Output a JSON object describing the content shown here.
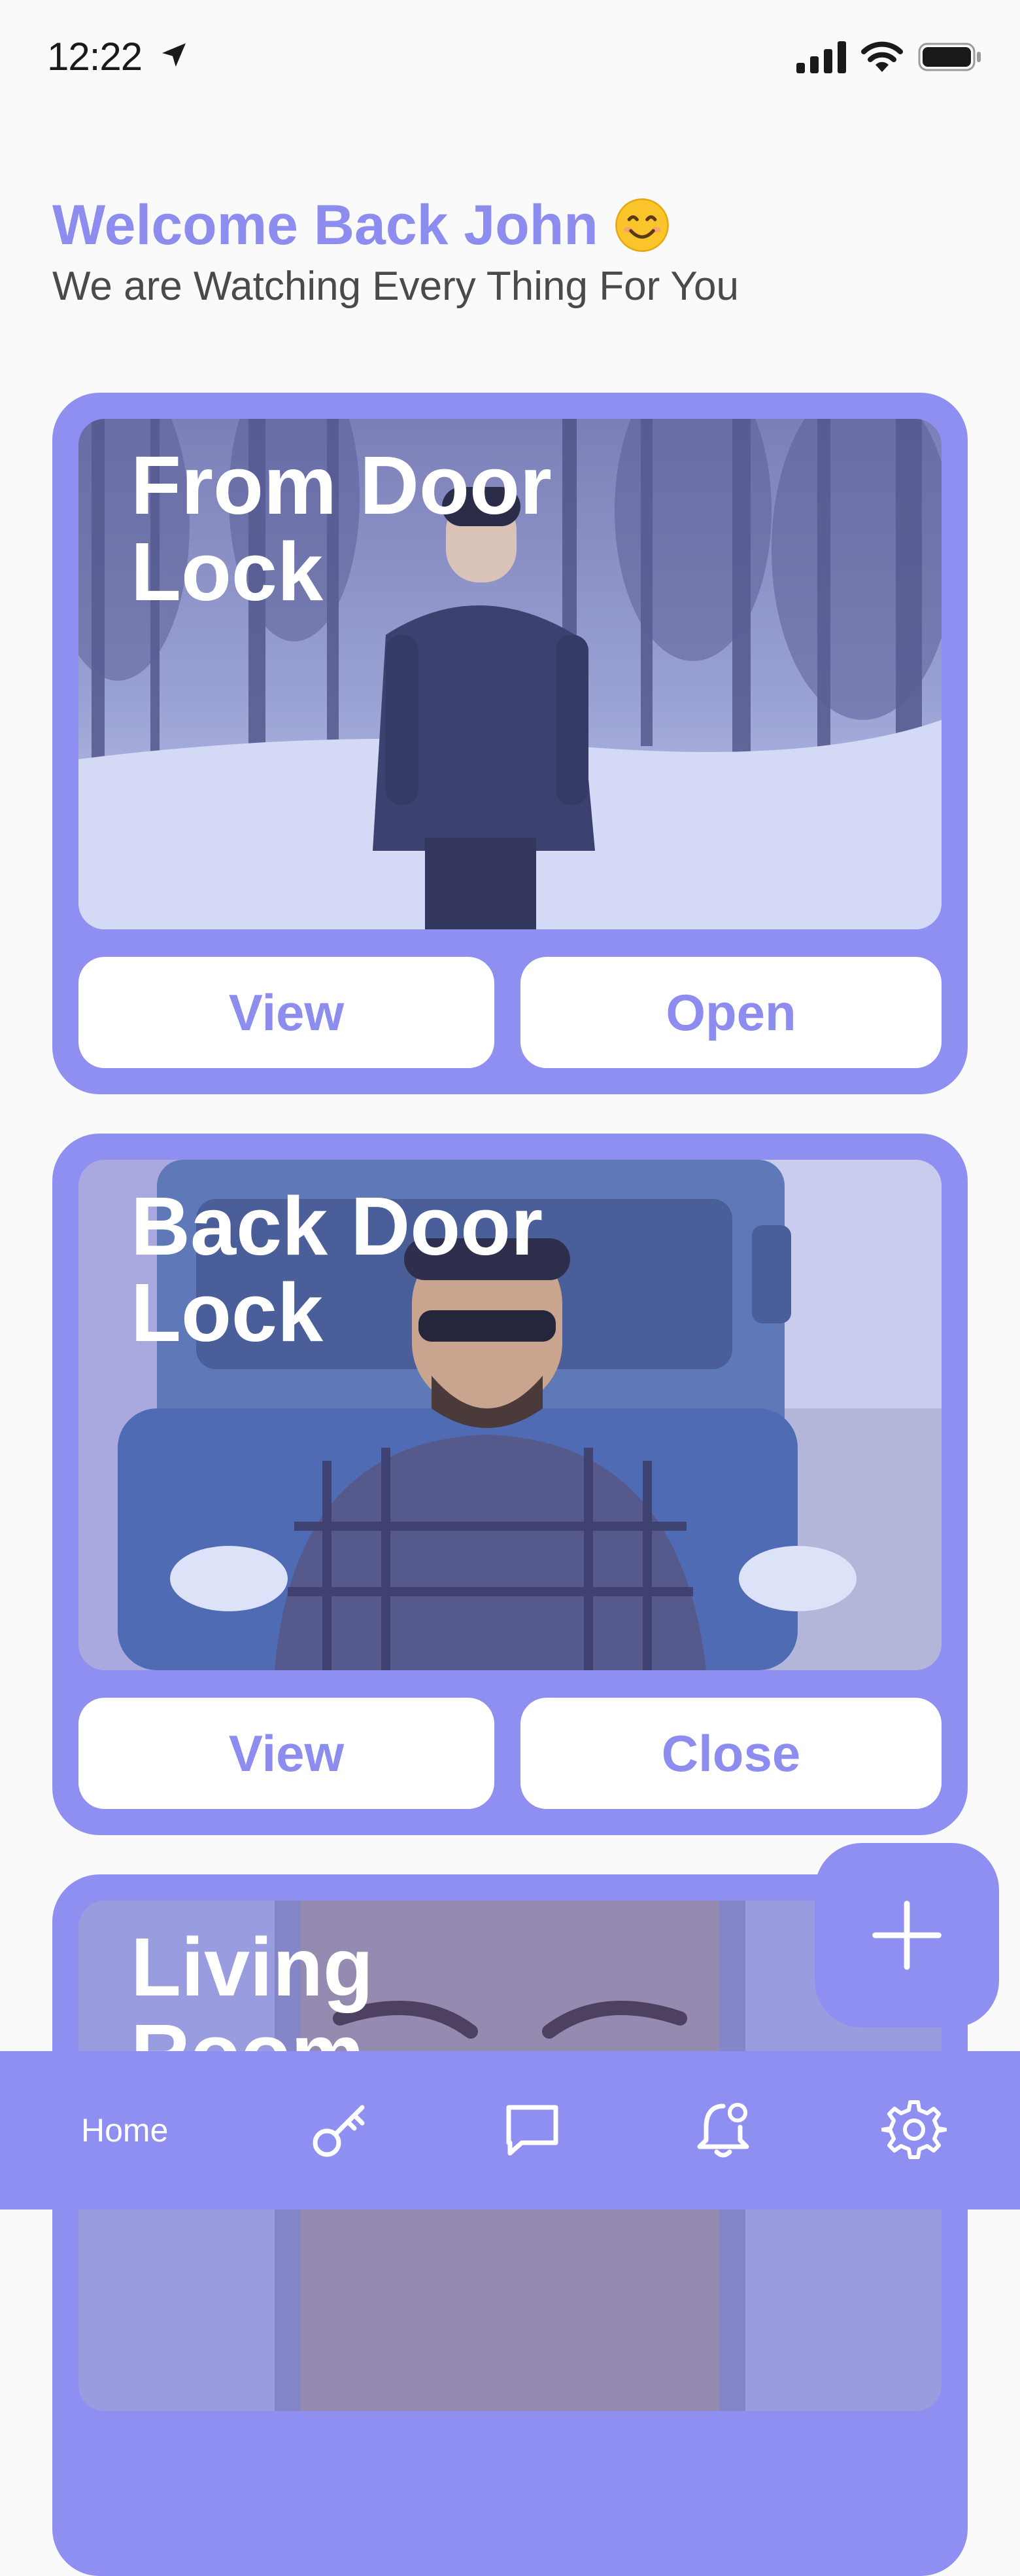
{
  "status_bar": {
    "time": "12:22"
  },
  "greeting": {
    "title": "Welcome Back John",
    "subtitle": "We are Watching Every Thing For You"
  },
  "cards": [
    {
      "title": "From Door Lock",
      "left_button": "View",
      "right_button": "Open"
    },
    {
      "title": "Back Door Lock",
      "left_button": "View",
      "right_button": "Close"
    },
    {
      "title": "Living Room"
    }
  ],
  "bottom_nav": {
    "home_label": "Home",
    "icons": [
      "key-icon",
      "chat-icon",
      "notification-bell-icon",
      "settings-gear-icon"
    ]
  },
  "colors": {
    "accent": "#8f8ff2",
    "accent_text": "#8d8df0",
    "background": "#fafafa"
  }
}
